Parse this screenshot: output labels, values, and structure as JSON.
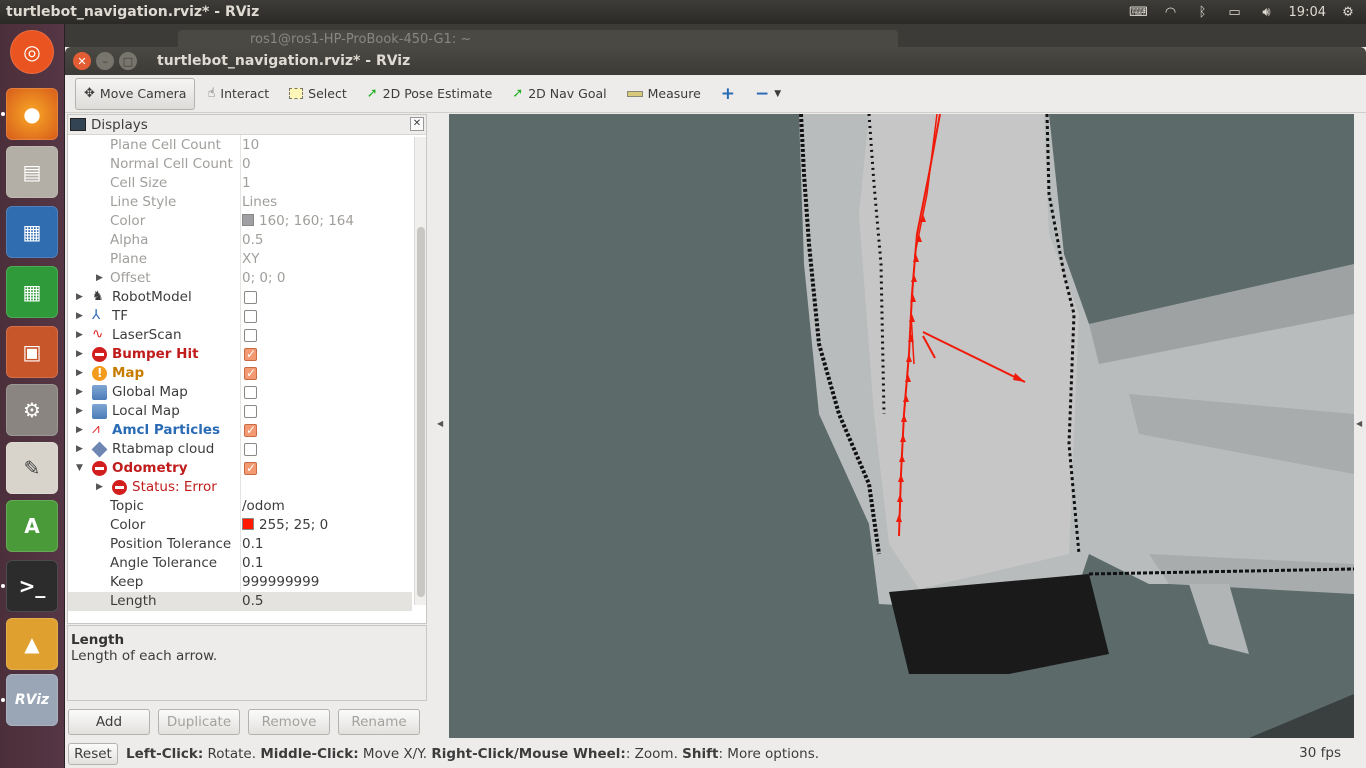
{
  "top_panel": {
    "title": "turtlebot_navigation.rviz* - RViz",
    "clock": "19:04",
    "icons": [
      "keyboard-icon",
      "wifi-icon",
      "bluetooth-icon",
      "battery-icon",
      "volume-icon",
      "settings-gear-icon"
    ]
  },
  "launcher": {
    "items": [
      "ubuntu-dash",
      "firefox",
      "files",
      "libreoffice-writer",
      "libreoffice-calc",
      "libreoffice-impress",
      "system-settings",
      "text-editor",
      "software-updater",
      "terminal",
      "matlab",
      "rviz"
    ]
  },
  "background_window": {
    "title": "ros1@ros1-HP-ProBook-450-G1: ~"
  },
  "window": {
    "title": "turtlebot_navigation.rviz* - RViz"
  },
  "toolbar": {
    "move_camera": "Move Camera",
    "interact": "Interact",
    "select": "Select",
    "pose_estimate": "2D Pose Estimate",
    "nav_goal": "2D Nav Goal",
    "measure": "Measure"
  },
  "displays": {
    "title": "Displays",
    "rows": [
      {
        "name": "Plane Cell Count",
        "value": "10"
      },
      {
        "name": "Normal Cell Count",
        "value": "0"
      },
      {
        "name": "Cell Size",
        "value": "1"
      },
      {
        "name": "Line Style",
        "value": "Lines"
      },
      {
        "name": "Color",
        "value": "160; 160; 164"
      },
      {
        "name": "Alpha",
        "value": "0.5"
      },
      {
        "name": "Plane",
        "value": "XY"
      },
      {
        "name": "Offset",
        "value": "0; 0; 0"
      },
      {
        "name": "RobotModel",
        "checked": false
      },
      {
        "name": "TF",
        "checked": false
      },
      {
        "name": "LaserScan",
        "checked": false
      },
      {
        "name": "Bumper Hit",
        "checked": true,
        "state": "error"
      },
      {
        "name": "Map",
        "checked": true,
        "state": "warning"
      },
      {
        "name": "Global Map",
        "checked": false
      },
      {
        "name": "Local Map",
        "checked": false
      },
      {
        "name": "Amcl Particles",
        "checked": true,
        "state": "ok"
      },
      {
        "name": "Rtabmap cloud",
        "checked": false
      },
      {
        "name": "Odometry",
        "checked": true,
        "state": "error"
      },
      {
        "name": "Status: Error"
      },
      {
        "name": "Topic",
        "value": "/odom"
      },
      {
        "name": "Color",
        "value": "255; 25; 0"
      },
      {
        "name": "Position Tolerance",
        "value": "0.1"
      },
      {
        "name": "Angle Tolerance",
        "value": "0.1"
      },
      {
        "name": "Keep",
        "value": "999999999"
      },
      {
        "name": "Length",
        "value": "0.5"
      }
    ]
  },
  "description": {
    "title": "Length",
    "text": "Length of each arrow."
  },
  "buttons": {
    "add": "Add",
    "duplicate": "Duplicate",
    "remove": "Remove",
    "rename": "Rename"
  },
  "status": {
    "reset": "Reset",
    "left_click_label": "Left-Click:",
    "left_click": " Rotate. ",
    "middle_click_label": "Middle-Click:",
    "middle_click": " Move X/Y. ",
    "right_click_label": "Right-Click/Mouse Wheel:",
    "right_click": ": Zoom. ",
    "shift_label": "Shift",
    "shift": ": More options.",
    "fps": "30 fps"
  },
  "colors": {
    "grid_color_swatch": "#a0a0a4",
    "odom_color_swatch": "#ff1900",
    "error": "#c01c1c",
    "warning": "#c77c00",
    "ok": "#2a6bb5"
  }
}
